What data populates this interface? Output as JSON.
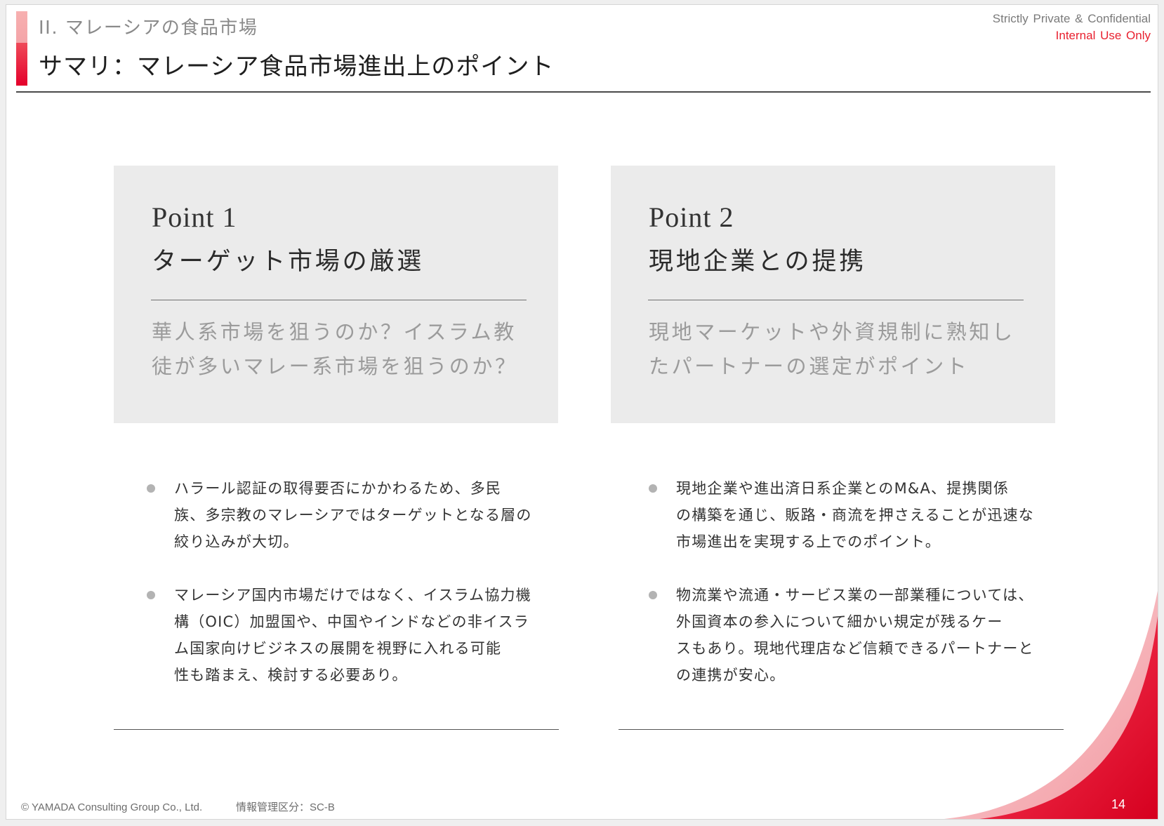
{
  "header": {
    "section": "II. マレーシアの食品市場",
    "title": "サマリ：マレーシア食品市場進出上のポイント",
    "confidential": "Strictly Private & Confidential",
    "internal": "Internal Use Only"
  },
  "points": [
    {
      "label": "Point 1",
      "heading": "ターゲット市場の厳選",
      "question_lines": [
        "華人系市場を狙うのか？イスラム教",
        "徒が多いマレー系市場を狙うのか？"
      ],
      "bullets": [
        {
          "lines": [
            "ハラール認証の取得要否にかかわるため、多民",
            "族、多宗教のマレーシアではターゲットとなる層の",
            "絞り込みが大切。"
          ]
        },
        {
          "lines": [
            "マレーシア国内市場だけではなく、イスラム協力機",
            "構（OIC）加盟国や、中国やインドなどの非イスラ",
            "ム国家向けビジネスの展開を視野に入れる可能",
            "性も踏まえ、検討する必要あり。"
          ]
        }
      ]
    },
    {
      "label": "Point 2",
      "heading": "現地企業との提携",
      "question_lines": [
        "現地マーケットや外資規制に熟知し",
        "たパートナーの選定がポイント"
      ],
      "bullets": [
        {
          "lines": [
            "現地企業や進出済日系企業とのM&A、提携関係",
            "の構築を通じ、販路・商流を押さえることが迅速な",
            "市場進出を実現する上でのポイント。"
          ]
        },
        {
          "lines": [
            "物流業や流通・サービス業の一部業種については、",
            "外国資本の参入について細かい規定が残るケー",
            "スもあり。現地代理店など信頼できるパートナーと",
            "の連携が安心。"
          ]
        }
      ]
    }
  ],
  "footer": {
    "copyright": "© YAMADA Consulting  Group  Co., Ltd.",
    "classification": "情報管理区分：SC-B",
    "page_number": "14"
  },
  "colors": {
    "accent_red": "#e4002b",
    "accent_pink": "#f4a4a8",
    "box_bg": "#ebebeb",
    "internal_red": "#e8202f"
  }
}
